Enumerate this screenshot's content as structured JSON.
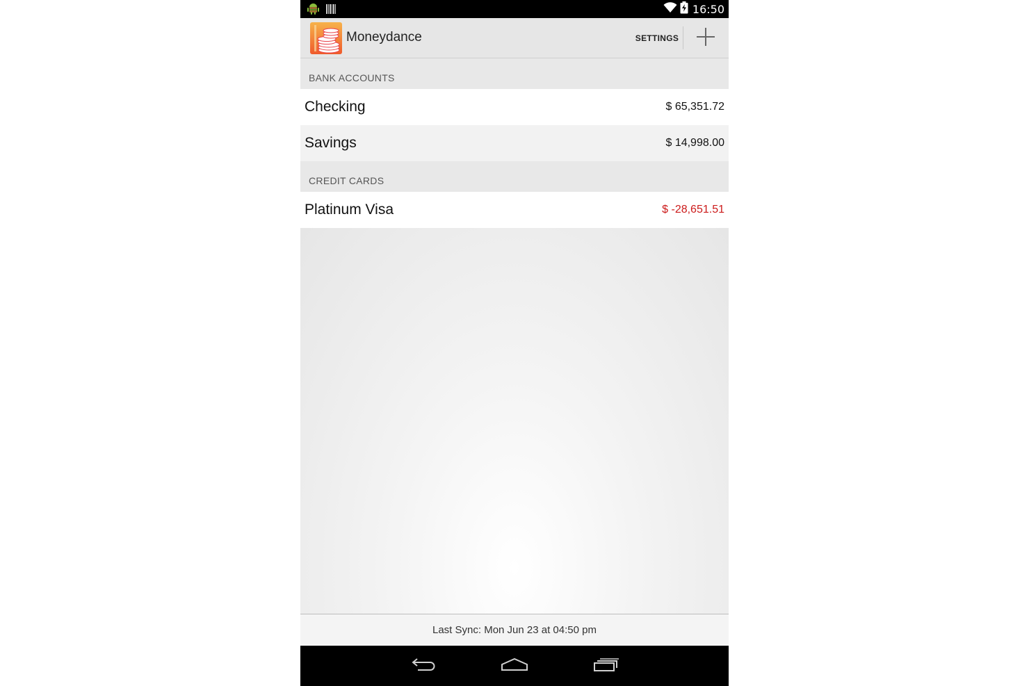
{
  "status_bar": {
    "time": "16:50",
    "left_icons": [
      "android-icon",
      "barcode-icon"
    ],
    "right_icons": [
      "wifi-icon",
      "battery-charging-icon"
    ]
  },
  "action_bar": {
    "app_icon": "moneydance-logo",
    "title": "Moneydance",
    "settings_label": "SETTINGS",
    "add_icon": "plus-icon"
  },
  "sections": [
    {
      "header": "BANK ACCOUNTS",
      "accounts": [
        {
          "name": "Checking",
          "balance": "$ 65,351.72",
          "negative": false
        },
        {
          "name": "Savings",
          "balance": "$ 14,998.00",
          "negative": false
        }
      ]
    },
    {
      "header": "CREDIT CARDS",
      "accounts": [
        {
          "name": "Platinum Visa",
          "balance": "$ -28,651.51",
          "negative": true
        }
      ]
    }
  ],
  "footer": {
    "last_sync": "Last Sync: Mon Jun 23 at 04:50 pm"
  },
  "nav_bar": {
    "buttons": [
      "back-icon",
      "home-icon",
      "recent-apps-icon"
    ]
  },
  "colors": {
    "negative": "#cc1a1a",
    "logo_orange": "#f39a3c",
    "logo_red": "#e6404a"
  }
}
